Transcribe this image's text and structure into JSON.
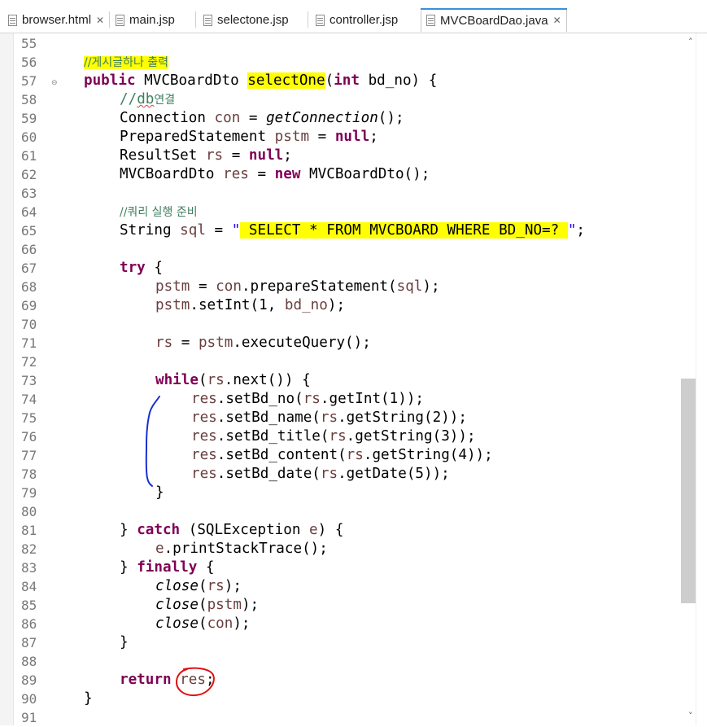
{
  "tabs": [
    {
      "label": "browser.html",
      "close": "✕",
      "active": false
    },
    {
      "label": "main.jsp",
      "close": "",
      "active": false
    },
    {
      "label": "selectone.jsp",
      "close": "",
      "active": false
    },
    {
      "label": "controller.jsp",
      "close": "",
      "active": false
    },
    {
      "label": "MVCBoardDao.java",
      "close": "✕",
      "active": true
    }
  ],
  "line_numbers": [
    "55",
    "56",
    "57",
    "58",
    "59",
    "60",
    "61",
    "62",
    "63",
    "64",
    "65",
    "66",
    "67",
    "68",
    "69",
    "70",
    "71",
    "72",
    "73",
    "74",
    "75",
    "76",
    "77",
    "78",
    "79",
    "80",
    "81",
    "82",
    "83",
    "84",
    "85",
    "86",
    "87",
    "88",
    "89",
    "90",
    "91"
  ],
  "fold_marker": "⊖",
  "code": {
    "l56": {
      "comment": "//게시글하나 출력"
    },
    "l57": {
      "kw_public": "public",
      "type": " MVCBoardDto ",
      "method": "selectOne",
      "open": "(",
      "kw_int": "int",
      "rest": " bd_no) {"
    },
    "l58": {
      "slashes": "//",
      "db": "db",
      "kr": "연결"
    },
    "l59": {
      "a": "Connection ",
      "v": "con",
      "b": " = ",
      "call": "getConnection",
      "c": "();"
    },
    "l60": {
      "a": "PreparedStatement ",
      "v": "pstm",
      "b": " = ",
      "kw": "null",
      "c": ";"
    },
    "l61": {
      "a": "ResultSet ",
      "v": "rs",
      "b": " = ",
      "kw": "null",
      "c": ";"
    },
    "l62": {
      "a": "MVCBoardDto ",
      "v": "res",
      "b": " = ",
      "kw": "new",
      "c": " MVCBoardDto();"
    },
    "l64": {
      "comment": "//쿼리 실행 준비"
    },
    "l65": {
      "a": "String ",
      "v": "sql",
      "b": " = ",
      "q1": "\"",
      "s": " SELECT * FROM MVCBOARD WHERE BD_NO=? ",
      "q2": "\"",
      "c": ";"
    },
    "l67": {
      "kw": "try",
      "c": " {"
    },
    "l68": {
      "v1": "pstm",
      "b": " = ",
      "v2": "con",
      "c": ".prepareStatement(",
      "v3": "sql",
      "d": ");"
    },
    "l69": {
      "v1": "pstm",
      "c": ".setInt(1, ",
      "v2": "bd_no",
      "d": ");"
    },
    "l71": {
      "v1": "rs",
      "b": " = ",
      "v2": "pstm",
      "c": ".executeQuery();"
    },
    "l73": {
      "kw": "while",
      "b": "(",
      "v": "rs",
      "c": ".next()) {"
    },
    "l74": {
      "v1": "res",
      "c": ".setBd_no(",
      "v2": "rs",
      "d": ".getInt(1));"
    },
    "l75": {
      "v1": "res",
      "c": ".setBd_name(",
      "v2": "rs",
      "d": ".getString(2));"
    },
    "l76": {
      "v1": "res",
      "c": ".setBd_title(",
      "v2": "rs",
      "d": ".getString(3));"
    },
    "l77": {
      "v1": "res",
      "c": ".setBd_content(",
      "v2": "rs",
      "d": ".getString(4));"
    },
    "l78": {
      "v1": "res",
      "c": ".setBd_date(",
      "v2": "rs",
      "d": ".getDate(5));"
    },
    "l79": {
      "c": "}"
    },
    "l81": {
      "a": "} ",
      "kw": "catch",
      "b": " (SQLException ",
      "v": "e",
      "c": ") {"
    },
    "l82": {
      "v": "e",
      "c": ".printStackTrace();"
    },
    "l83": {
      "a": "} ",
      "kw": "finally",
      "c": " {"
    },
    "l84": {
      "call": "close",
      "b": "(",
      "v": "rs",
      "c": ");"
    },
    "l85": {
      "call": "close",
      "b": "(",
      "v": "pstm",
      "c": ");"
    },
    "l86": {
      "call": "close",
      "b": "(",
      "v": "con",
      "c": ");"
    },
    "l87": {
      "c": "}"
    },
    "l89": {
      "kw": "return",
      "b": " ",
      "v": "res",
      "c": ";"
    },
    "l90": {
      "c": "}"
    }
  },
  "scrollbar": {
    "up": "˄",
    "down": "˅"
  },
  "colors": {
    "keyword": "#7f0055",
    "comment": "#3f7f5f",
    "string": "#2a00ff",
    "variable": "#6a3e3e",
    "highlight": "#ffff00",
    "annotation_blue": "#1a2fd0",
    "annotation_red": "#e01010"
  }
}
